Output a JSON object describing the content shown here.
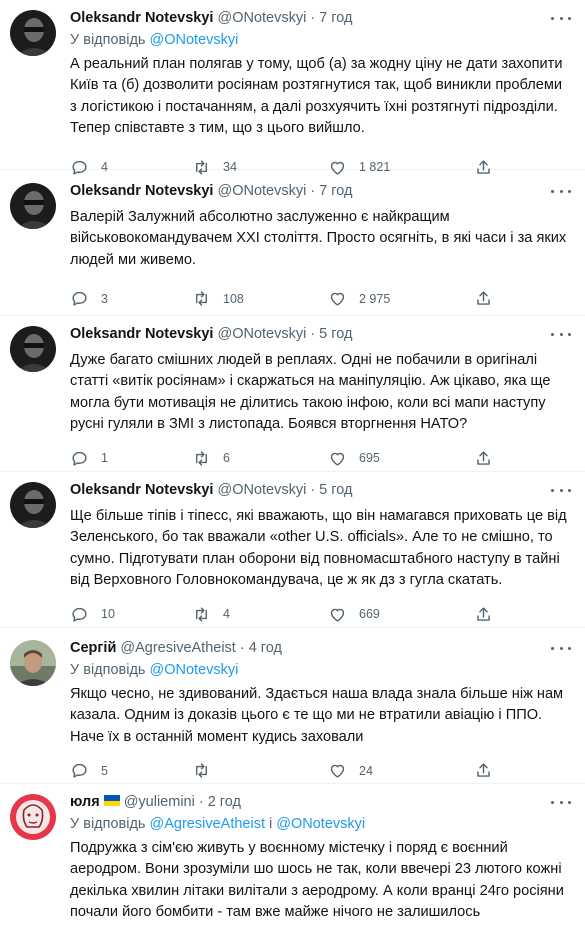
{
  "tweets": [
    {
      "name": "Oleksandr Notevskyi",
      "handle": "@ONotevskyi",
      "time": "7 год",
      "reply_prefix": "У відповідь ",
      "reply_to": "@ONotevskyi",
      "text": "А реальний план полягав у тому, щоб (а) за жодну ціну не дати захопити Київ та (б) дозволити росіянам розтягнутися так, щоб виникли проблеми з логістикою і постачанням, а далі розхуячить їхні розтягнуті підрозділи. Тепер співставте з тим, що з цього вийшло.",
      "replies": "4",
      "retweets": "34",
      "likes": "1 821",
      "avatar": "dark-portrait"
    },
    {
      "name": "Oleksandr Notevskyi",
      "handle": "@ONotevskyi",
      "time": "7 год",
      "text": "Валерій Залужний абсолютно заслуженно є найкращим військовокомандувачем XXI століття. Просто осягніть, в які часи і за яких людей ми живемо.",
      "replies": "3",
      "retweets": "108",
      "likes": "2 975",
      "avatar": "dark-portrait"
    },
    {
      "name": "Oleksandr Notevskyi",
      "handle": "@ONotevskyi",
      "time": "5 год",
      "text": "Дуже багато смішних людей в реплаях. Одні не побачили в оригіналі статті «витік росіянам» і скаржаться на маніпуляцію. Аж цікаво, яка ще могла бути мотивація не ділитись такою інфою, коли всі мапи наступу русні гуляли в ЗМІ з листопада. Боявся вторгнення НАТО?",
      "replies": "1",
      "retweets": "6",
      "likes": "695",
      "avatar": "dark-portrait"
    },
    {
      "name": "Oleksandr Notevskyi",
      "handle": "@ONotevskyi",
      "time": "5 год",
      "text": "Ще більше тіпів і тіпесс, які вважають, що він намагався приховать це від Зеленського, бо так вважали «other U.S. officials».  Але то не смішно, то сумно. Підготувати план оборони від повномасштабного наступу в тайні від Верховного Головнокомандувача, це ж як дз з гугла скатать.",
      "replies": "10",
      "retweets": "4",
      "likes": "669",
      "avatar": "dark-portrait"
    },
    {
      "name": "Сергій",
      "handle": "@AgresiveAtheist",
      "time": "4 год",
      "reply_prefix": "У відповідь ",
      "reply_to": "@ONotevskyi",
      "text": "Якщо чесно, не здивований. Здається наша влада знала більше ніж нам казала. Одним із доказів цього є те що ми не втратили авіацію і ППО. Наче їх в останній момент кудись заховали",
      "replies": "5",
      "retweets": "",
      "likes": "24",
      "avatar": "outdoor-photo"
    },
    {
      "name": "юля",
      "handle": "@yuliemini",
      "time": "2 год",
      "flag": true,
      "reply_prefix": "У відповідь ",
      "reply_to": "@AgresiveAtheist",
      "reply_joiner": " і ",
      "reply_to2": "@ONotevskyi",
      "text": "Подружка з сім'єю живуть у воєнному містечку і поряд є воєнний аеродром. Вони зрозуміли шо шось не так, коли ввечері 23 лютого кожні декілька хвилин літаки вилітали з аеродрому. А коли вранці 24го росіяни почали його бомбити - там вже майже нічого не залишилось",
      "avatar": "red-sketch"
    }
  ],
  "separator": "·",
  "colors": {
    "link": "#1d9bf0",
    "secondary": "#536471",
    "text": "#0f1419",
    "divider": "#eff3f4"
  },
  "icons": [
    "reply-icon",
    "retweet-icon",
    "like-icon",
    "share-icon",
    "more-icon"
  ]
}
